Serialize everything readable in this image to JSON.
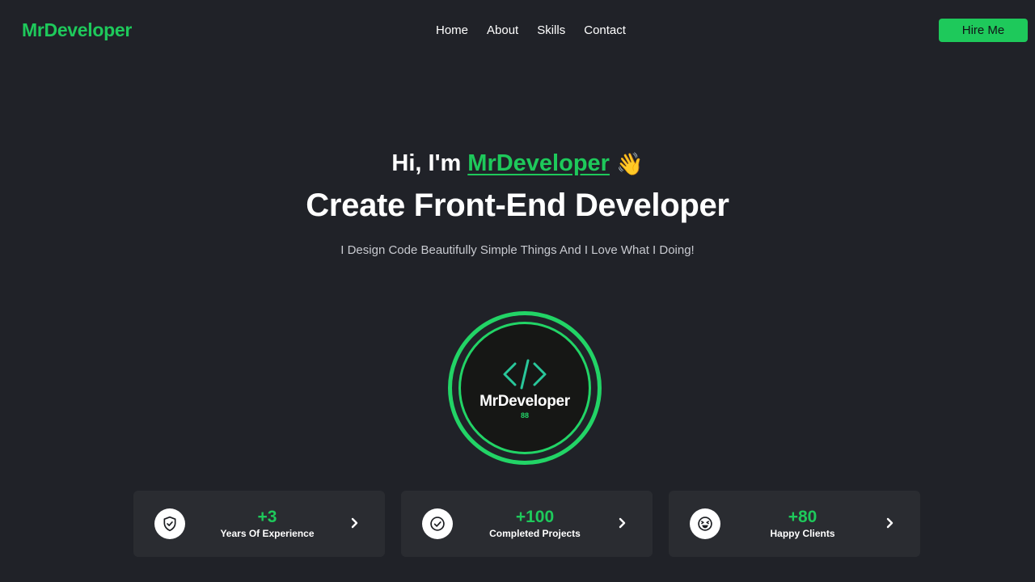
{
  "nav": {
    "brand": "MrDeveloper",
    "links": [
      "Home",
      "About",
      "Skills",
      "Contact"
    ],
    "hire_label": "Hire Me"
  },
  "hero": {
    "greeting_prefix": "Hi, I'm",
    "greeting_name": "MrDeveloper",
    "greeting_emoji": "👋",
    "headline": "Create Front-End Developer",
    "tagline": "I Design Code Beautifully Simple Things And I Love What I Doing!"
  },
  "badge": {
    "title": "MrDeveloper",
    "subtitle": "88",
    "icon": "code-icon"
  },
  "stats": [
    {
      "value": "+3",
      "label": "Years Of Experience",
      "icon": "shield-check-icon"
    },
    {
      "value": "+100",
      "label": "Completed Projects",
      "icon": "check-circle-icon"
    },
    {
      "value": "+80",
      "label": "Happy Clients",
      "icon": "laughing-face-icon"
    }
  ],
  "colors": {
    "accent": "#1ec95b",
    "background": "#202228",
    "card": "#2a2c31"
  }
}
